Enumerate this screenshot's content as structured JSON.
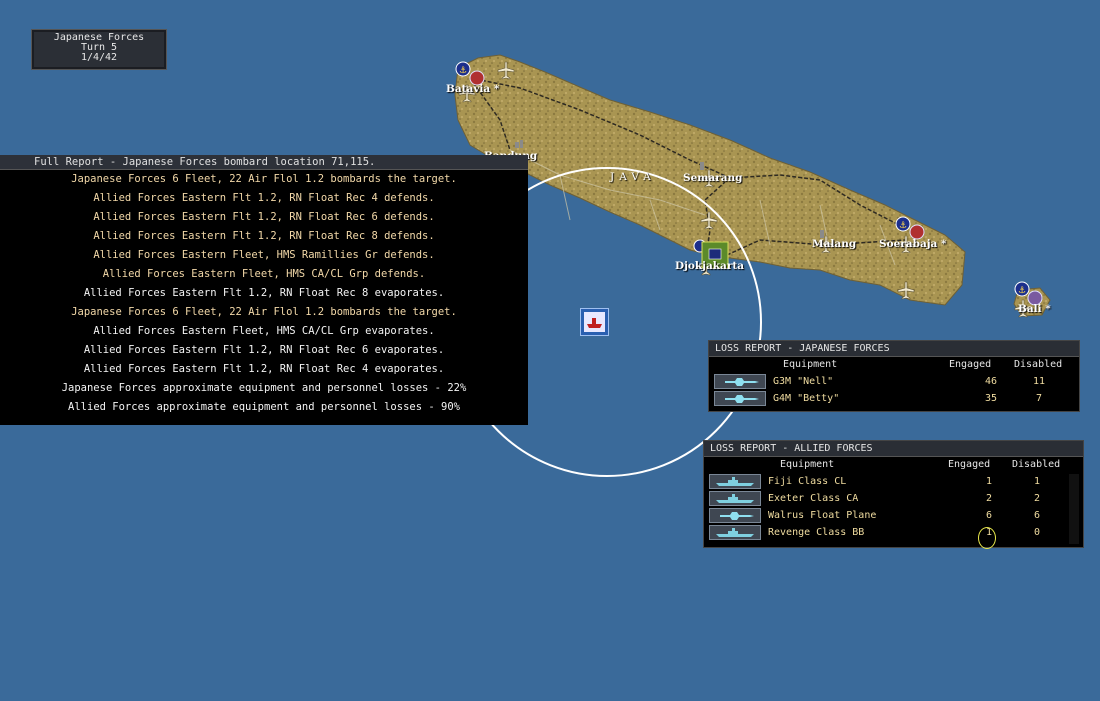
{
  "turn_box": {
    "side": "Japanese Forces",
    "turn": "Turn 5",
    "date": "1/4/42"
  },
  "full_report": {
    "title": "Full Report -  Japanese Forces bombard location 71,115.",
    "lines": [
      {
        "text": "Japanese Forces 6 Fleet, 22 Air Flol 1.2 bombards the target.",
        "side": "jp"
      },
      {
        "text": "Allied Forces Eastern Flt 1.2, RN Float Rec 4 defends.",
        "side": "jp"
      },
      {
        "text": "Allied Forces Eastern Flt 1.2, RN Float Rec 6 defends.",
        "side": "jp"
      },
      {
        "text": "Allied Forces Eastern Flt 1.2, RN Float Rec 8 defends.",
        "side": "jp"
      },
      {
        "text": "Allied Forces Eastern Fleet, HMS Ramillies Gr defends.",
        "side": "jp"
      },
      {
        "text": "Allied Forces Eastern Fleet, HMS CA/CL Grp defends.",
        "side": "jp"
      },
      {
        "text": "Allied Forces Eastern Flt 1.2, RN Float Rec 8 evaporates.",
        "side": "al"
      },
      {
        "text": "Japanese Forces 6 Fleet, 22 Air Flol 1.2 bombards the target.",
        "side": "jp"
      },
      {
        "text": "Allied Forces Eastern Fleet, HMS CA/CL Grp evaporates.",
        "side": "al"
      },
      {
        "text": "Allied Forces Eastern Flt 1.2, RN Float Rec 6 evaporates.",
        "side": "al"
      },
      {
        "text": "Allied Forces Eastern Flt 1.2, RN Float Rec 4 evaporates.",
        "side": "al"
      },
      {
        "text": "Japanese Forces approximate equipment and personnel losses - 22%",
        "side": "al"
      },
      {
        "text": "Allied Forces approximate equipment and personnel losses - 90%",
        "side": "al"
      }
    ]
  },
  "loss_jp": {
    "title": "LOSS REPORT -  JAPANESE FORCES",
    "col_equipment": "Equipment",
    "col_engaged": "Engaged",
    "col_disabled": "Disabled",
    "rows": [
      {
        "name": "G3M \"Nell\"",
        "engaged": "46",
        "disabled": "11",
        "icon": "aircraft-icon"
      },
      {
        "name": "G4M \"Betty\"",
        "engaged": "35",
        "disabled": "7",
        "icon": "aircraft-icon"
      }
    ]
  },
  "loss_al": {
    "title": "LOSS REPORT -  ALLIED FORCES",
    "col_equipment": "Equipment",
    "col_engaged": "Engaged",
    "col_disabled": "Disabled",
    "rows": [
      {
        "name": "Fiji Class CL",
        "engaged": "1",
        "disabled": "1",
        "icon": "ship-icon"
      },
      {
        "name": "Exeter Class CA",
        "engaged": "2",
        "disabled": "2",
        "icon": "ship-icon"
      },
      {
        "name": "Walrus Float Plane",
        "engaged": "6",
        "disabled": "6",
        "icon": "aircraft-icon"
      },
      {
        "name": "Revenge Class BB",
        "engaged": "1",
        "disabled": "0",
        "icon": "ship-icon"
      }
    ]
  },
  "map": {
    "island": "JAVA",
    "cities": {
      "batavia": "Batavia *",
      "bandung": "Bandung",
      "semarang": "Semarang",
      "djokjakarta": "Djokjakarta",
      "malang": "Malang",
      "soerabaja": "Soerabaja *",
      "bali": "Bali *"
    },
    "colors": {
      "sea": "#3a6a9a",
      "land": "#b19b5c",
      "panel": "#000000"
    }
  }
}
